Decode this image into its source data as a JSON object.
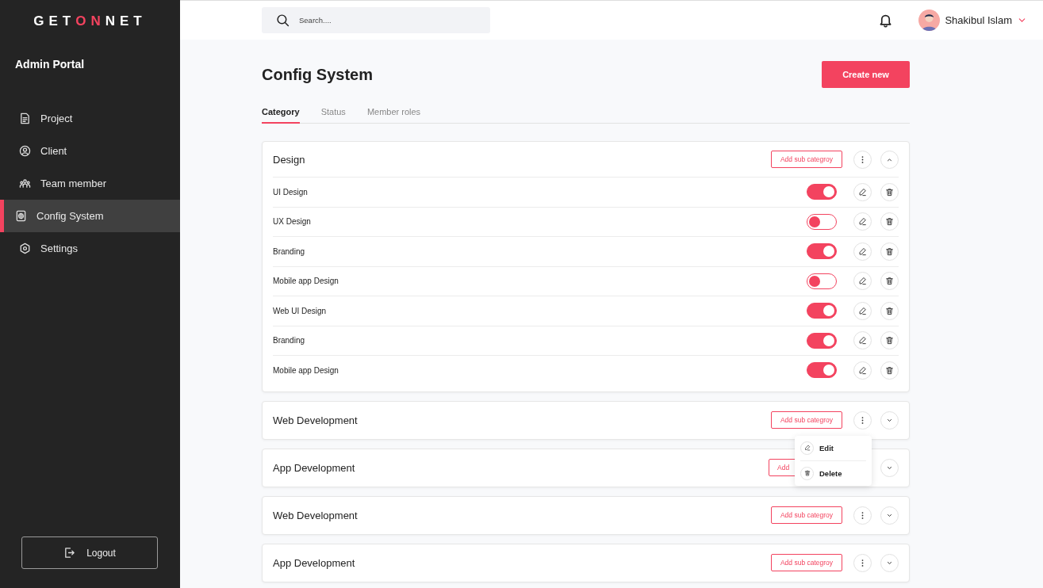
{
  "logo": {
    "parts": [
      {
        "text": "GET",
        "accent": false
      },
      {
        "text": "ON",
        "accent": true
      },
      {
        "text": "NET",
        "accent": false
      }
    ]
  },
  "sidebar": {
    "title": "Admin Portal",
    "items": [
      {
        "label": "Project",
        "kind": "document",
        "selected": false
      },
      {
        "label": "Client",
        "kind": "user",
        "selected": false
      },
      {
        "label": "Team member",
        "kind": "team",
        "selected": false
      },
      {
        "label": "Config System",
        "kind": "config",
        "selected": true
      },
      {
        "label": "Settings",
        "kind": "settings",
        "selected": false
      }
    ],
    "logout": "Logout"
  },
  "search": {
    "placeholder": "Search...."
  },
  "user": {
    "name": "Shakibul Islam"
  },
  "page": {
    "title": "Config System",
    "create_button": "Create new"
  },
  "tabs": [
    {
      "label": "Category",
      "selected": true
    },
    {
      "label": "Status",
      "selected": false
    },
    {
      "label": "Member roles",
      "selected": false
    }
  ],
  "categories": [
    {
      "name": "Design",
      "expanded": true,
      "add_label": "Add sub categroy",
      "subcategories": [
        {
          "name": "UI Design",
          "on": true
        },
        {
          "name": "UX Design",
          "on": false
        },
        {
          "name": "Branding",
          "on": true
        },
        {
          "name": "Mobile app Design",
          "on": false
        },
        {
          "name": "Web UI Design",
          "on": true
        },
        {
          "name": "Branding",
          "on": true
        },
        {
          "name": "Mobile app Design",
          "on": true
        }
      ]
    },
    {
      "name": "Web Development",
      "expanded": false,
      "add_label": "Add sub categroy",
      "menu": [
        {
          "label": "Edit",
          "kind": "edit"
        },
        {
          "label": "Delete",
          "kind": "delete"
        }
      ]
    },
    {
      "name": "App Development",
      "expanded": false,
      "add_label": "Add"
    },
    {
      "name": "Web Development",
      "expanded": false,
      "add_label": "Add sub categroy"
    },
    {
      "name": "App Development",
      "expanded": false,
      "add_label": "Add sub categroy"
    }
  ]
}
